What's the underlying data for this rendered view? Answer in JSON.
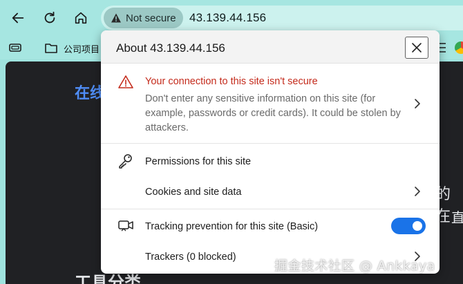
{
  "browser": {
    "security_label": "Not secure",
    "url": "43.139.44.156",
    "bookmark_label": "公司项目"
  },
  "background_page": {
    "blue_heading": "在线",
    "right_text_1": "的在",
    "right_text_2": "直",
    "bottom_heading": "工具分类"
  },
  "watermark": "掘金技术社区 @ Ankkaya",
  "popup": {
    "title": "About 43.139.44.156",
    "insecure": {
      "heading": "Your connection to this site isn't secure",
      "body": "Don't enter any sensitive information on this site (for example, passwords or credit cards). It could be stolen by attackers."
    },
    "permissions": {
      "heading": "Permissions for this site",
      "cookies_label": "Cookies and site data"
    },
    "tracking": {
      "heading": "Tracking prevention for this site (Basic)",
      "enabled": true,
      "trackers_label": "Trackers (0 blocked)"
    }
  },
  "colors": {
    "toggle_on": "#1a73e8",
    "warning_red": "#c42b1c",
    "toolbar_bg": "#a6e6e1"
  },
  "icons": {
    "back": "back-arrow-icon",
    "refresh": "refresh-icon",
    "home": "home-icon",
    "warning": "warning-triangle-icon",
    "key": "key-icon",
    "camera": "tracking-camera-icon",
    "chevron": "chevron-right-icon",
    "close": "close-icon"
  }
}
